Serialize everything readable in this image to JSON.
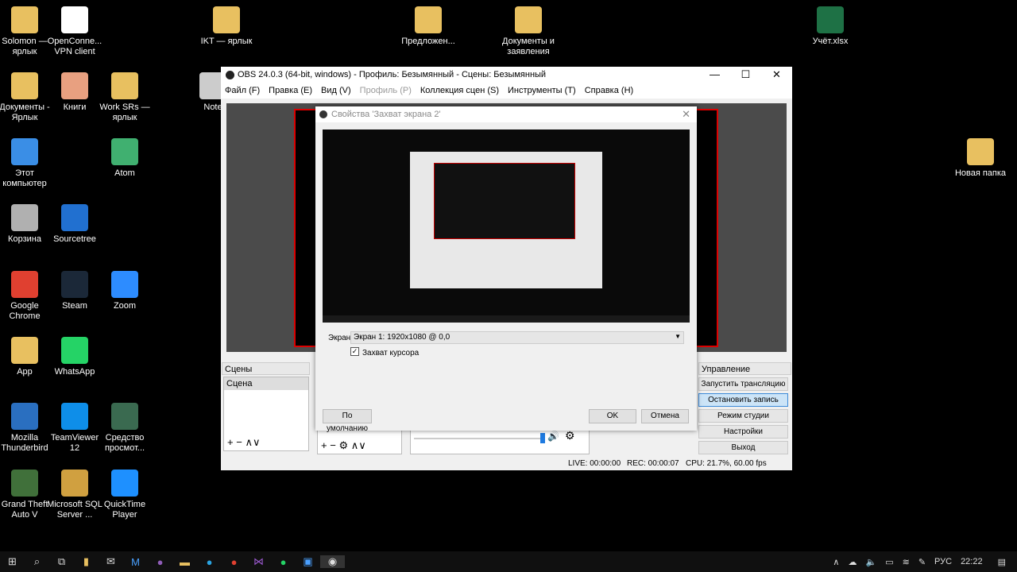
{
  "desktop": {
    "icons": [
      {
        "label": "Solomon — ярлык",
        "color": "#e8c060"
      },
      {
        "label": "OpenConne... VPN client",
        "color": "#ffffff"
      },
      {
        "label": "IKT — ярлык",
        "color": "#e8c060"
      },
      {
        "label": "Предложен...",
        "color": "#e8c060"
      },
      {
        "label": "Документы и заявления",
        "color": "#e8c060"
      },
      {
        "label": "Учёт.xlsx",
        "color": "#1e7145"
      },
      {
        "label": "Документы - Ярлык",
        "color": "#e8c060"
      },
      {
        "label": "Книги",
        "color": "#e8a080"
      },
      {
        "label": "Work SRs — ярлык",
        "color": "#e8c060"
      },
      {
        "label": "Note",
        "color": "#cccccc"
      },
      {
        "label": "Этот компьютер",
        "color": "#3a8ee6"
      },
      {
        "label": "Atom",
        "color": "#40b070"
      },
      {
        "label": "Новая папка",
        "color": "#e8c060"
      },
      {
        "label": "Корзина",
        "color": "#b0b0b0"
      },
      {
        "label": "Sourcetree",
        "color": "#2170d0"
      },
      {
        "label": "Google Chrome",
        "color": "#e04030"
      },
      {
        "label": "Steam",
        "color": "#1b2838"
      },
      {
        "label": "Zoom",
        "color": "#2d8cff"
      },
      {
        "label": "App",
        "color": "#e8c060"
      },
      {
        "label": "WhatsApp",
        "color": "#25d366"
      },
      {
        "label": "Mozilla Thunderbird",
        "color": "#2a6fc0"
      },
      {
        "label": "TeamViewer 12",
        "color": "#0e8ee9"
      },
      {
        "label": "Средство просмот...",
        "color": "#3a6a50"
      },
      {
        "label": "Grand Theft Auto V",
        "color": "#40703a"
      },
      {
        "label": "Microsoft SQL Server ...",
        "color": "#d0a040"
      },
      {
        "label": "QuickTime Player",
        "color": "#1e90ff"
      }
    ]
  },
  "obs": {
    "title": "OBS 24.0.3 (64-bit, windows) - Профиль: Безымянный - Сцены: Безымянный",
    "menu": [
      "Файл (F)",
      "Правка (E)",
      "Вид (V)",
      "Профиль (P)",
      "Коллекция сцен (S)",
      "Инструменты (T)",
      "Справка (H)"
    ],
    "scenes_header": "Сцены",
    "scene_item": "Сцена",
    "controls_header": "Управление",
    "controls": [
      "Запустить трансляцию",
      "Остановить запись",
      "Режим студии",
      "Настройки",
      "Выход"
    ],
    "status": {
      "live": "LIVE: 00:00:00",
      "rec": "REC: 00:00:07",
      "cpu": "CPU: 21.7%, 60.00 fps"
    }
  },
  "dialog": {
    "title": "Свойства 'Захват экрана 2'",
    "screen_label": "Экран",
    "screen_value": "Экран 1: 1920x1080 @ 0,0",
    "cursor_label": "Захват курсора",
    "cursor_checked": true,
    "defaults": "По умолчанию",
    "ok": "OK",
    "cancel": "Отмена"
  },
  "taskbar": {
    "lang": "РУС",
    "time": "22:22"
  }
}
